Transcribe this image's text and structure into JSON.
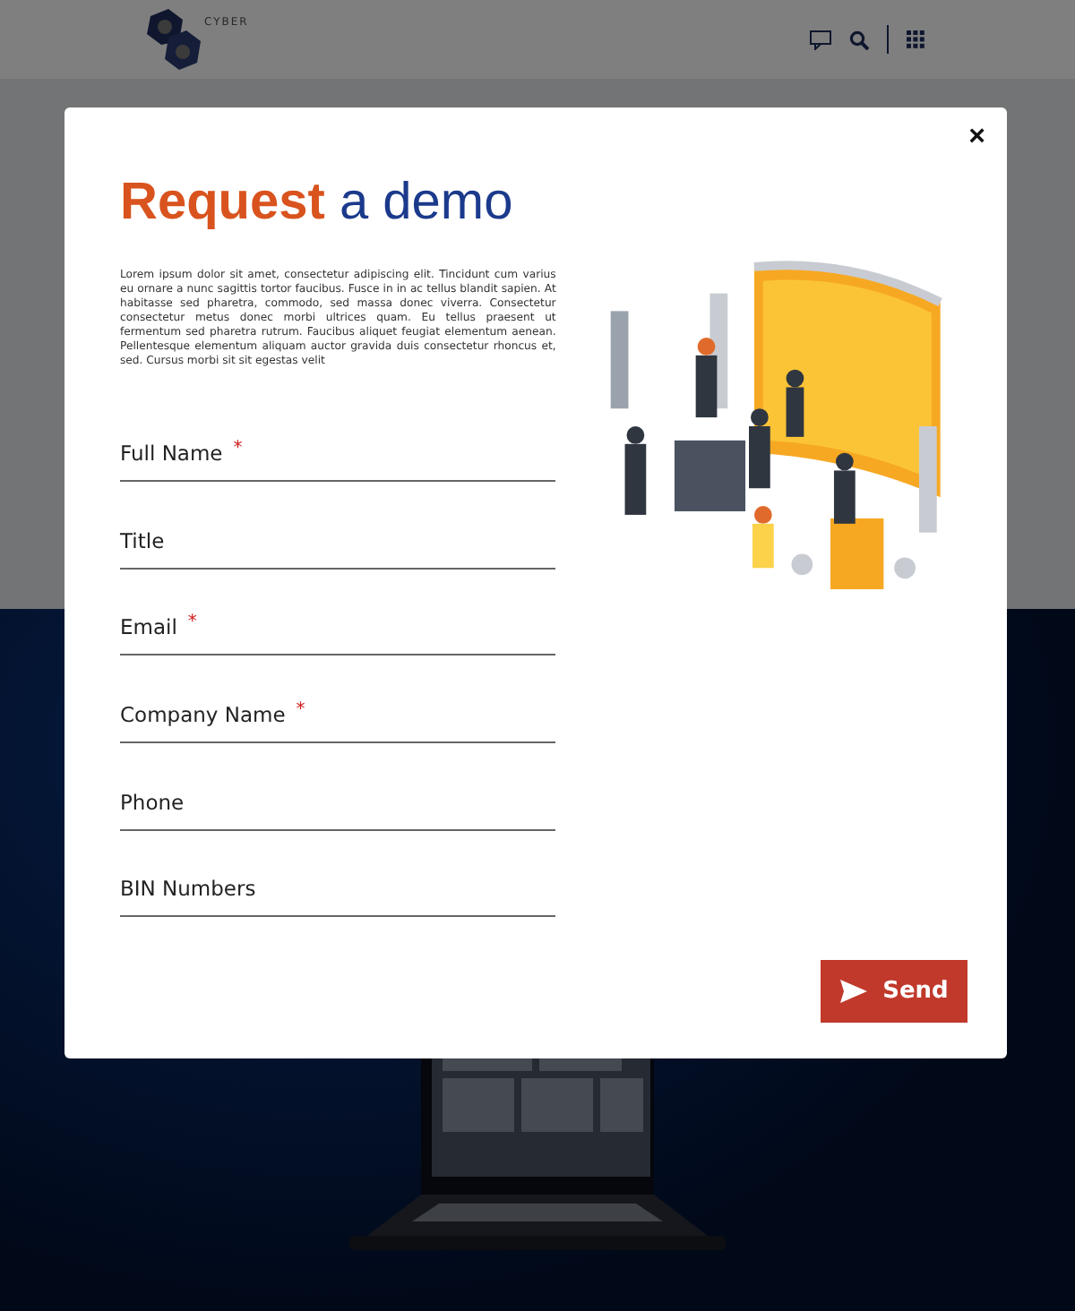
{
  "header": {
    "logo_text": "CYBER"
  },
  "dialog": {
    "close": "×",
    "title_bold": "Request",
    "title_rest": "a demo",
    "intro": "Lorem ipsum dolor sit amet, consectetur adipiscing elit. Tincidunt cum varius eu ornare a nunc sagittis tortor faucibus. Fusce in in ac tellus blandit sapien. At habitasse sed pharetra, commodo, sed massa donec viverra. Consectetur consectetur metus donec morbi ultrices quam. Eu tellus praesent ut fermentum sed pharetra rutrum. Faucibus aliquet feugiat elementum aenean. Pellentesque elementum aliquam auctor gravida duis consectetur rhoncus et, sed. Cursus morbi sit sit egestas velit",
    "required_mark": "*",
    "fields": [
      {
        "placeholder": "Full Name",
        "required": true
      },
      {
        "placeholder": "Title",
        "required": false
      },
      {
        "placeholder": "Email",
        "required": true
      },
      {
        "placeholder": "Company Name",
        "required": true
      },
      {
        "placeholder": "Phone",
        "required": false
      },
      {
        "placeholder": "BIN Numbers",
        "required": false
      }
    ],
    "send_button": "Send"
  }
}
